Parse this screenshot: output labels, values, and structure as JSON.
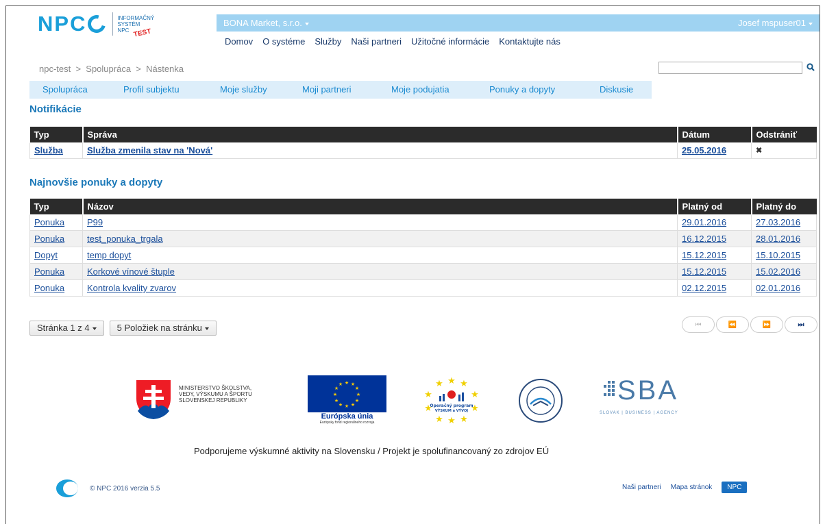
{
  "header": {
    "logo_text": "NPC",
    "logo_subtitle_lines": [
      "INFORMAČNÝ",
      "SYSTÉM",
      "NPC"
    ],
    "logo_badge": "TEST",
    "company": "BONA Market, s.r.o.",
    "user": "Josef mspuser01"
  },
  "main_nav": [
    "Domov",
    "O systéme",
    "Služby",
    "Naši partneri",
    "Užitočné informácie",
    "Kontaktujte nás"
  ],
  "breadcrumb": "npc-test  >  Spolupráca  >  Nástenka",
  "search": {
    "placeholder": "",
    "value": ""
  },
  "sub_nav": [
    "Spolupráca",
    "Profil subjektu",
    "Moje služby",
    "Moji partneri",
    "Moje podujatia",
    "Ponuky a dopyty",
    "Diskusie"
  ],
  "notifications": {
    "title": "Notifikácie",
    "columns": [
      "Typ",
      "Správa",
      "Dátum",
      "Odstrániť"
    ],
    "rows": [
      {
        "type": "Služba",
        "message": "Služba zmenila stav na 'Nová'",
        "date": "25.05.2016",
        "remove": "✖"
      }
    ]
  },
  "offers": {
    "title": "Najnovšie ponuky a dopyty",
    "columns": [
      "Typ",
      "Názov",
      "Platný od",
      "Platný do"
    ],
    "rows": [
      {
        "type": "Ponuka",
        "name": "P99",
        "from": "29.01.2016",
        "to": "27.03.2016"
      },
      {
        "type": "Ponuka",
        "name": "test_ponuka_trgala",
        "from": "16.12.2015",
        "to": "28.01.2016"
      },
      {
        "type": "Dopyt",
        "name": "temp dopyt",
        "from": "15.12.2015",
        "to": "15.10.2015"
      },
      {
        "type": "Ponuka",
        "name": "Korkové vínové štuple",
        "from": "15.12.2015",
        "to": "15.02.2016"
      },
      {
        "type": "Ponuka",
        "name": "Kontrola kvality zvarov",
        "from": "02.12.2015",
        "to": "02.01.2016"
      }
    ]
  },
  "pager": {
    "page_label": "Stránka 1 z 4",
    "per_page_label": "5 Položiek na stránku",
    "first": "⏮",
    "prev": "⏪",
    "next": "⏩",
    "last": "⏭"
  },
  "logos": {
    "ministry_lines": [
      "MINISTERSTVO ŠKOLSTVA,",
      "VEDY, VÝSKUMU A ŠPORTU",
      "SLOVENSKEJ REPUBLIKY"
    ],
    "eu_label": "Európska únia",
    "eu_sub": "Európsky fond regionálneho rozvoja",
    "op_label_lines": [
      "Operačný program",
      "VÝSKUM a VÝVOJ"
    ],
    "sba_label": "SBA",
    "sba_sub": "SLOVAK | BUSINESS | AGENCY"
  },
  "support_text": "Podporujeme výskumné aktivity na Slovensku / Projekt je spolufinancovaný zo zdrojov EÚ",
  "footer": {
    "copyright": "© NPC 2016 verzia 5.5",
    "links": [
      "Naši partneri",
      "Mapa stránok"
    ],
    "badge": "NPC"
  },
  "colors": {
    "brand": "#1a9fd9",
    "topbar": "#9fd3f2",
    "subnav_bg": "#ddeefa",
    "table_header": "#2b2b2b",
    "heading": "#1a78b8"
  }
}
